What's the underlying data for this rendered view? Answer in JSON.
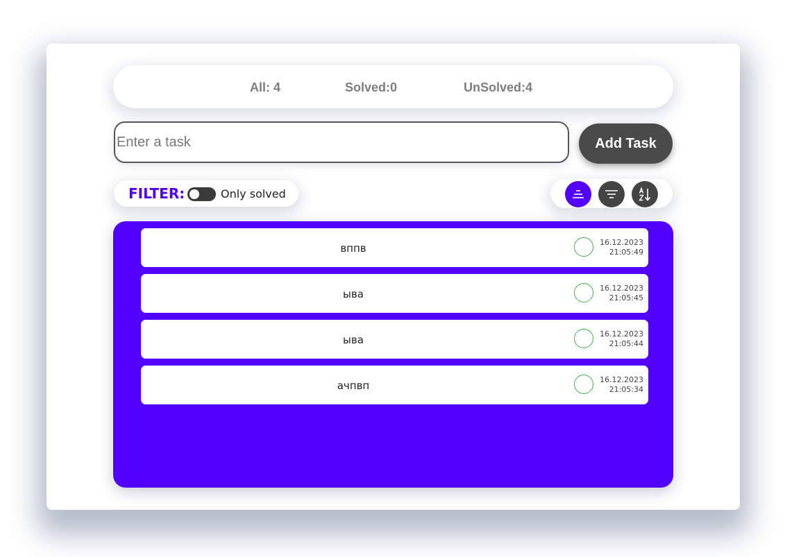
{
  "stats": {
    "all": "All: 4",
    "solved": "Solved:0",
    "unsolved": "UnSolved:4"
  },
  "task_input": {
    "placeholder": "Enter a task",
    "value": ""
  },
  "add_button": {
    "label": "Add Task"
  },
  "filter": {
    "label": "FILTER:",
    "toggle_label": "Only solved",
    "toggle_on": false
  },
  "sort": {
    "buttons": [
      {
        "icon": "align-center-icon",
        "active": true
      },
      {
        "icon": "filter-lines-icon",
        "active": false
      },
      {
        "icon": "sort-az-icon",
        "active": false
      }
    ]
  },
  "colors": {
    "accent": "#5200ff",
    "dark": "#444444",
    "check": "#3fb34f",
    "stat_text": "#7d7d80"
  },
  "tasks": [
    {
      "text": "вппв",
      "date": "16.12.2023",
      "time": "21:05:49",
      "solved": false
    },
    {
      "text": "ыва",
      "date": "16.12.2023",
      "time": "21:05:45",
      "solved": false
    },
    {
      "text": "ыва",
      "date": "16.12.2023",
      "time": "21:05:44",
      "solved": false
    },
    {
      "text": "ачпвп",
      "date": "16.12.2023",
      "time": "21:05:34",
      "solved": false
    }
  ]
}
